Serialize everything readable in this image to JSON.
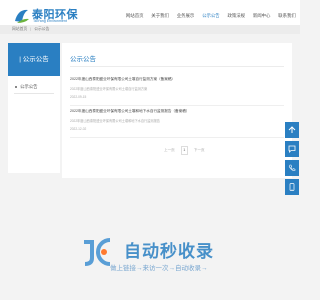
{
  "header": {
    "logo_cn": "泰阳环保",
    "logo_en": "TaiYang Environment",
    "nav": [
      {
        "label": "网站首页",
        "active": false
      },
      {
        "label": "关于我们",
        "active": false
      },
      {
        "label": "业务展示",
        "active": false
      },
      {
        "label": "公示公告",
        "active": true
      },
      {
        "label": "政策法规",
        "active": false
      },
      {
        "label": "新闻中心",
        "active": false
      },
      {
        "label": "联系我们",
        "active": false
      }
    ]
  },
  "breadcrumb": {
    "home": "网站首页",
    "separator": "|",
    "current": "公示公告"
  },
  "sidebar": {
    "title": "| 公示公告",
    "items": [
      {
        "label": "公示公告"
      }
    ]
  },
  "main": {
    "title": "公示公告",
    "news": [
      {
        "title": "2022年度山西泰阳盛业环保有限公司土壤自行监测方案（备案稿）",
        "desc": "2022年度山西泰阳盛业环保有限公司土壤自行监测方案",
        "date": "2022-09-15"
      },
      {
        "title": "2022年度山西泰阳盛业环保有限公司土壤和地下水自行监测报告（备案稿）",
        "desc": "2022年度山西泰阳盛业环保有限公司土壤和地下水自行监测报告",
        "date": "2022-12-02"
      }
    ],
    "pager": {
      "prev": "上一页",
      "current": "1",
      "next": "下一页"
    }
  },
  "float_bar": {
    "icons": [
      "arrow-up-icon",
      "chat-icon",
      "phone-icon",
      "tablet-icon"
    ]
  },
  "watermark": {
    "main": "自动秒收录",
    "sub": "做上链接→来访一次→自动收录→"
  },
  "colors": {
    "accent": "#2a7fc2",
    "background": "#f3f3f3"
  }
}
